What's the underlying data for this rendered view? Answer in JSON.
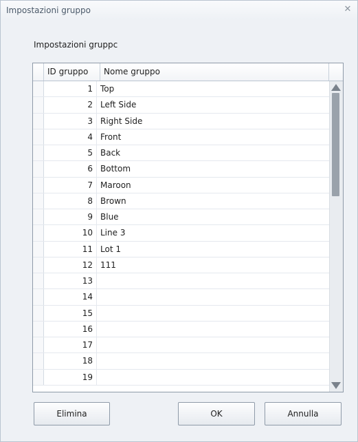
{
  "window": {
    "title": "Impostazioni gruppo",
    "close_symbol": "✕"
  },
  "section_label": "Impostazioni gruppc",
  "grid": {
    "columns": [
      "ID gruppo",
      "Nome gruppo"
    ],
    "rows": [
      {
        "id": "1",
        "name": "Top"
      },
      {
        "id": "2",
        "name": "Left Side"
      },
      {
        "id": "3",
        "name": "Right Side"
      },
      {
        "id": "4",
        "name": "Front"
      },
      {
        "id": "5",
        "name": "Back"
      },
      {
        "id": "6",
        "name": "Bottom"
      },
      {
        "id": "7",
        "name": "Maroon"
      },
      {
        "id": "8",
        "name": "Brown"
      },
      {
        "id": "9",
        "name": "Blue"
      },
      {
        "id": "10",
        "name": "Line 3"
      },
      {
        "id": "11",
        "name": "Lot 1"
      },
      {
        "id": "12",
        "name": "111"
      },
      {
        "id": "13",
        "name": ""
      },
      {
        "id": "14",
        "name": ""
      },
      {
        "id": "15",
        "name": ""
      },
      {
        "id": "16",
        "name": ""
      },
      {
        "id": "17",
        "name": ""
      },
      {
        "id": "18",
        "name": ""
      },
      {
        "id": "19",
        "name": ""
      }
    ]
  },
  "buttons": {
    "delete": "Elimina",
    "ok": "OK",
    "cancel": "Annulla"
  },
  "icons": {
    "close": "close-icon",
    "scroll_up": "scroll-up-arrow-icon",
    "scroll_down": "scroll-down-arrow-icon"
  }
}
